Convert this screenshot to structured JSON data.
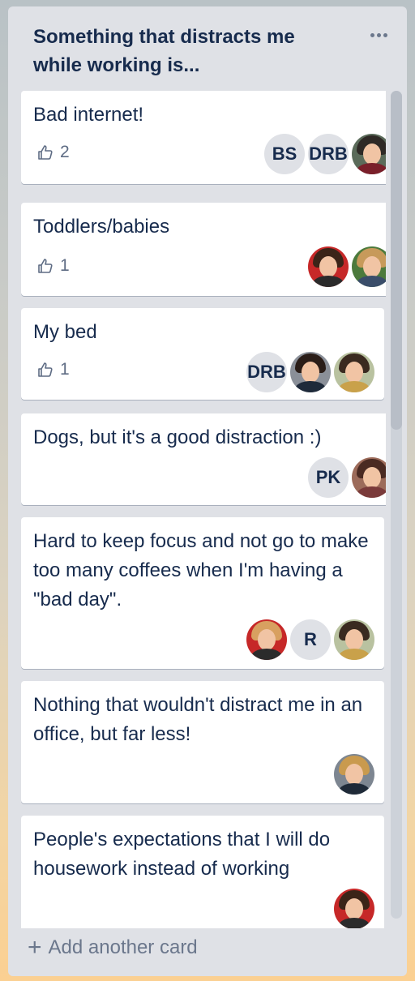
{
  "list": {
    "title": "Something that distracts me while working is...",
    "menu_icon": "ellipsis-icon",
    "add_card_label": "Add another card",
    "add_icon": "plus-icon"
  },
  "cards": [
    {
      "text": "Bad internet!",
      "votes": "2",
      "avatars": [
        "BS",
        "DRB"
      ]
    },
    {
      "text": "Toddlers/babies",
      "votes": "1"
    },
    {
      "text": "My bed",
      "votes": "1",
      "avatars": [
        "DRB"
      ]
    },
    {
      "text": "Dogs, but it's a good distraction :)",
      "avatars": [
        "PK"
      ]
    },
    {
      "text": "Hard to keep focus and not go to make too many coffees when I'm having a \"bad day\".",
      "avatars": [
        "R"
      ]
    },
    {
      "text": "Nothing that wouldn't distract me in an office, but far less!"
    },
    {
      "text": "People's expectations that I will do housework instead of working"
    }
  ],
  "colors": {
    "list_bg": "#dfe1e6",
    "card_bg": "#ffffff",
    "text": "#172b4d",
    "muted": "#5e6c84",
    "avatar_bg": "#dfe1e6"
  },
  "icons": {
    "vote": "thumbs-up-icon"
  }
}
